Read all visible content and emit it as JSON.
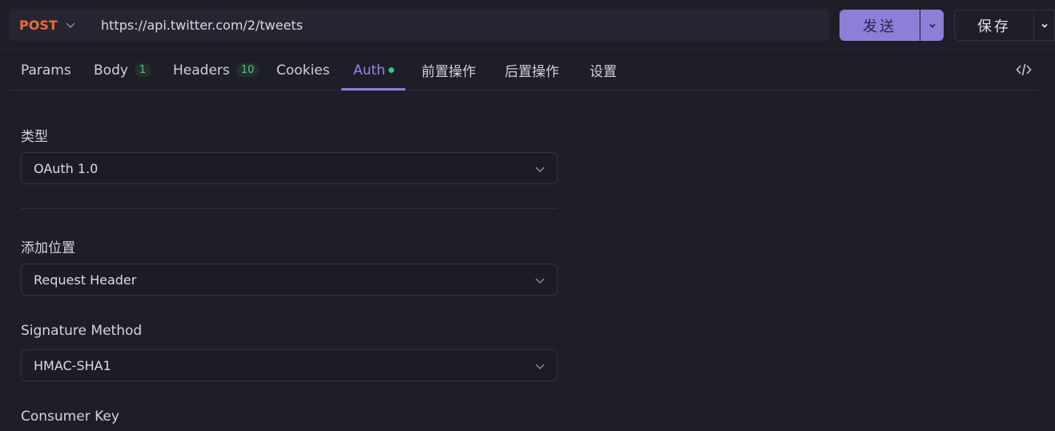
{
  "request": {
    "method": "POST",
    "url": "https://api.twitter.com/2/tweets",
    "send_label": "发送",
    "save_label": "保存"
  },
  "tabs": [
    {
      "label": "Params"
    },
    {
      "label": "Body",
      "badge": "1"
    },
    {
      "label": "Headers",
      "badge": "10"
    },
    {
      "label": "Cookies"
    },
    {
      "label": "Auth",
      "active": true
    },
    {
      "label": "前置操作"
    },
    {
      "label": "后置操作"
    },
    {
      "label": "设置"
    }
  ],
  "auth": {
    "type_label": "类型",
    "type_value": "OAuth 1.0",
    "add_to_label": "添加位置",
    "add_to_value": "Request Header",
    "signature_label": "Signature Method",
    "signature_value": "HMAC-SHA1",
    "consumer_key_label": "Consumer Key"
  },
  "colors": {
    "method": "#ef6a36",
    "accent": "#8b7fd8",
    "auth_dot": "#2ecc71",
    "badge": "#4cc38a"
  },
  "icons": {
    "method_dropdown": "chevron-down-icon",
    "send_dropdown": "chevron-down-icon",
    "save_dropdown": "chevron-down-icon",
    "code": "code-icon",
    "select_dropdown": "chevron-down-icon"
  }
}
